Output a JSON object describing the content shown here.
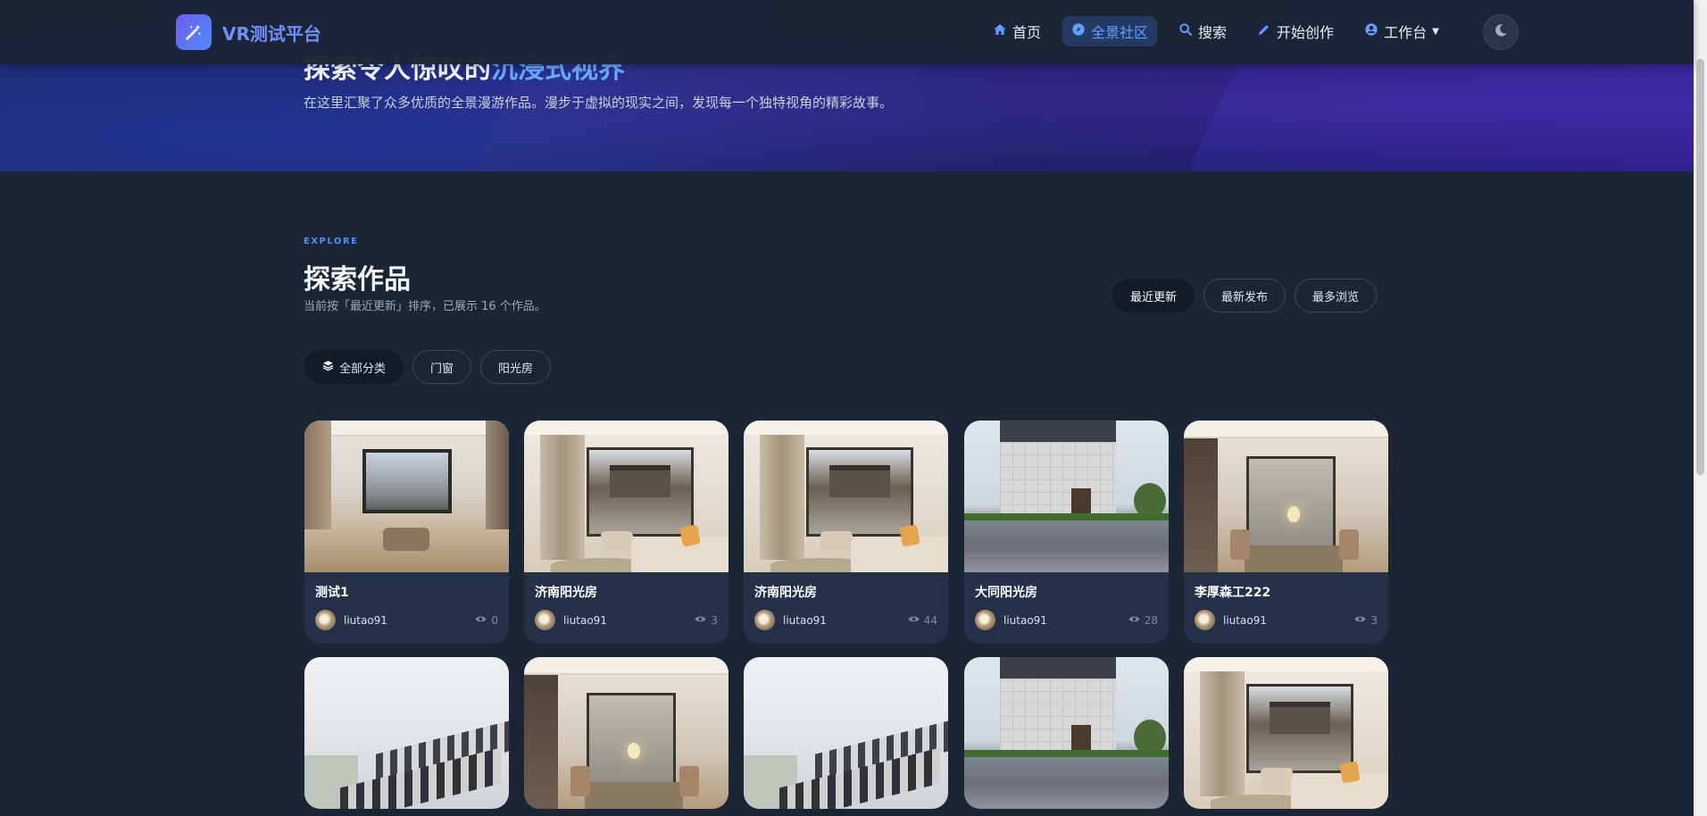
{
  "nav": {
    "brand": "VR测试平台",
    "brand_icon": "magic-wand-icon",
    "items": [
      {
        "label": "首页",
        "icon": "home-icon",
        "active": false
      },
      {
        "label": "全景社区",
        "icon": "compass-icon",
        "active": true
      },
      {
        "label": "搜索",
        "icon": "search-icon",
        "active": false
      },
      {
        "label": "开始创作",
        "icon": "pencil-icon",
        "active": false
      },
      {
        "label": "工作台",
        "icon": "user-circle-icon",
        "active": false,
        "dropdown": true
      }
    ],
    "theme_toggle_icon": "moon-icon"
  },
  "hero": {
    "title_part1": "探索令人惊叹的",
    "title_highlight": "沉浸式视界",
    "description": "在这里汇聚了众多优质的全景漫游作品。漫步于虚拟的现实之间，发现每一个独特视角的精彩故事。"
  },
  "section": {
    "eyebrow": "EXPLORE",
    "title": "探索作品",
    "subtitle": "当前按「最近更新」排序，已展示 16 个作品。",
    "sort_options": [
      {
        "label": "最近更新",
        "active": true
      },
      {
        "label": "最新发布",
        "active": false
      },
      {
        "label": "最多浏览",
        "active": false
      }
    ],
    "categories": [
      {
        "label": "全部分类",
        "icon": "layers-icon",
        "active": true
      },
      {
        "label": "门窗",
        "active": false
      },
      {
        "label": "阳光房",
        "active": false
      }
    ]
  },
  "works": [
    {
      "title": "测试1",
      "author": "liutao91",
      "views": "0",
      "scene": "interior"
    },
    {
      "title": "济南阳光房",
      "author": "liutao91",
      "views": "3",
      "scene": "lounge"
    },
    {
      "title": "济南阳光房",
      "author": "liutao91",
      "views": "44",
      "scene": "lounge"
    },
    {
      "title": "大同阳光房",
      "author": "liutao91",
      "views": "28",
      "scene": "exterior"
    },
    {
      "title": "李厚森工222",
      "author": "liutao91",
      "views": "3",
      "scene": "dining"
    },
    {
      "title": "",
      "author": "",
      "views": "",
      "scene": "aerial"
    },
    {
      "title": "",
      "author": "",
      "views": "",
      "scene": "dining"
    },
    {
      "title": "",
      "author": "",
      "views": "",
      "scene": "aerial"
    },
    {
      "title": "",
      "author": "",
      "views": "",
      "scene": "exterior"
    },
    {
      "title": "",
      "author": "",
      "views": "",
      "scene": "lounge"
    }
  ],
  "colors": {
    "accent": "#4b8ff5",
    "background": "#1c2536",
    "card": "#243149"
  }
}
